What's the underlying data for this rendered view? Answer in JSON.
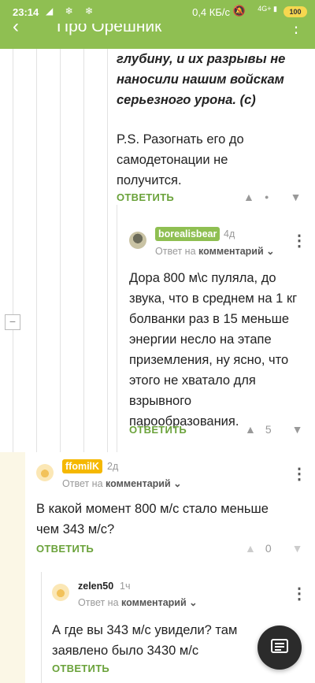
{
  "status": {
    "time": "23:14",
    "icons": "◢ ❄ ❄",
    "net": "0,4 КБ/с",
    "mute": "🔕",
    "signal": "4G+ ▮",
    "battery": "100"
  },
  "appbar": {
    "back": "‹",
    "title": "Про Орешник",
    "more": "⋮"
  },
  "thread": {
    "collapse_symbol": "−",
    "quote": "глубину, и их разрывы не наносили нашим войскам серьезного урона. (с)",
    "ps": "P.S. Разогнать его до самодетонации не получится.",
    "reply_label": "ОТВЕТИТЬ",
    "vote": {
      "up": "▲",
      "dot": "●",
      "down": "▼"
    }
  },
  "comments": [
    {
      "user": "borealisbear",
      "age": "4д",
      "reply_prefix": "Ответ на",
      "reply_target": "комментарий ⌄",
      "text": "Дора 800 м\\с пуляла, до звука, что в среднем на 1 кг болванки раз в 15 меньше энергии несло на этапе приземления, ну ясно, что этого не хватало для взрывного парообразования.",
      "reply_label": "ОТВЕТИТЬ",
      "score": "5",
      "user_color": "#8fbf52"
    },
    {
      "user": "ffomilK",
      "age": "2д",
      "reply_prefix": "Ответ на",
      "reply_target": "комментарий ⌄",
      "text": "В какой момент 800 м/с стало меньше чем 343 м/с?",
      "reply_label": "ОТВЕТИТЬ",
      "score": "0",
      "user_color": "#f5b800"
    },
    {
      "user": "zelen50",
      "age": "1ч",
      "reply_prefix": "Ответ на",
      "reply_target": "комментарий ⌄",
      "text": "А где вы 343 м/с увидели? там заявлено было 3430 м/с",
      "reply_label": "ОТВЕТИТЬ"
    }
  ],
  "kebab": "⋮"
}
